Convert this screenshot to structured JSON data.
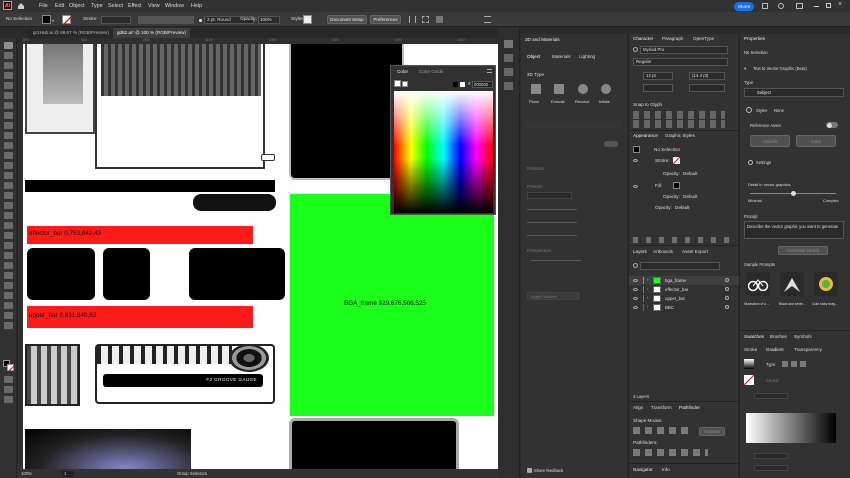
{
  "menu": {
    "items": [
      "File",
      "Edit",
      "Object",
      "Type",
      "Select",
      "Effect",
      "View",
      "Window",
      "Help"
    ],
    "share_label": "Share"
  },
  "control": {
    "selection_label": "No Selection",
    "stroke_label": "Stroke:",
    "stroke_profile": "3 pt. Round",
    "opacity_label": "Opacity:",
    "opacity_value": "100%",
    "styles_label": "Styles:",
    "doc_setup": "Document Setup",
    "preferences": "Preferences"
  },
  "tabs": [
    {
      "label": "gr1Hub.ai @ 66.67 % (RGB/Preview)"
    },
    {
      "label": "gd62.ai* @ 100 % (RGB/Preview)"
    }
  ],
  "rulers": [
    "800",
    "900",
    "1000",
    "1100",
    "1200",
    "1300",
    "1400",
    "1500"
  ],
  "canvas": {
    "effector_label": "effector_bar 0,753,842,43",
    "upper_label": "upper_bar 0,931,840,62",
    "bga_label": "BGA_frame 929,676,506,525",
    "gauge_label": "F2 GROOVE GAUGE"
  },
  "color_panel": {
    "tab1": "Color",
    "tab2": "Color Guide",
    "hex": "000000"
  },
  "status": {
    "zoom": "100%",
    "page": "1",
    "tool": "Group Selection"
  },
  "panel3d": {
    "tab": "3D and Materials",
    "subtabs": [
      "Object",
      "Materials",
      "Lighting"
    ],
    "type_label": "3D Type",
    "types": [
      "Plane",
      "Extrude",
      "Revolve",
      "Inflate"
    ],
    "rotation_label": "Rotation",
    "presets_label": "Presets",
    "perspective_label": "Perspective",
    "apply_label": "Apply Rotation",
    "render_label": "Share feedback"
  },
  "character": {
    "tabs": [
      "Character",
      "Paragraph",
      "OpenType"
    ],
    "font": "Myriad Pro",
    "style": "Regular",
    "size": "12 pt",
    "leading": "(14.4 pt)",
    "snap_label": "Snap to Glyph"
  },
  "appearance": {
    "tabs": [
      "Appearance",
      "Graphic Styles"
    ],
    "no_selection": "No Selection",
    "stroke": "Stroke:",
    "opacity1": "Opacity:",
    "opacity1_val": "Default",
    "fill": "Fill:",
    "opacity2": "Opacity:",
    "opacity2_val": "Default",
    "opacity3": "Opacity:",
    "opacity3_val": "Default",
    "fx": "fx"
  },
  "layers": {
    "tabs": [
      "Layers",
      "Artboards",
      "Asset Export"
    ],
    "items": [
      {
        "name": "bga_frame",
        "color": "#33cc33"
      },
      {
        "name": "effector_bar",
        "color": "#ff3b3b"
      },
      {
        "name": "upper_bar",
        "color": "#ff3b3b"
      },
      {
        "name": "BBC",
        "color": "#3366ff"
      }
    ],
    "count": "4 Layers"
  },
  "align": {
    "tabs": [
      "Align",
      "Transform",
      "Pathfinder"
    ],
    "shape_modes": "Shape Modes:",
    "pathfinders": "Pathfinders:",
    "expand": "Expand",
    "nav_tabs": [
      "Navigator",
      "Info"
    ]
  },
  "properties": {
    "tab": "Properties",
    "no_selection": "No Selection",
    "text_to_vector": "Text to Vector Graphic (Beta)",
    "type_label": "Type",
    "type_value": "Subject",
    "styles_label": "Styles",
    "styles_value": "None",
    "reference_label": "Reference Asset",
    "scene_label": "Artwork",
    "color_label": "Color",
    "settings_label": "Settings",
    "detail_label": "Detail in vector graphics",
    "minimal": "Minimal",
    "complex": "Complex",
    "prompt_label": "Prompt",
    "prompt_text": "Describe the vector graphic you want to generate",
    "generate": "Generate (Beta)",
    "sample_label": "Sample Prompts",
    "samples": [
      "Illustration of a ...",
      "Black and white...",
      "Cute baby drag..."
    ]
  },
  "swatches": {
    "tabs": [
      "Swatches",
      "Brushes",
      "Symbols"
    ],
    "gtabs": [
      "Stroke",
      "Gradient",
      "Transparency"
    ],
    "type_label": "Type:",
    "stroke_label": "Stroke:"
  }
}
